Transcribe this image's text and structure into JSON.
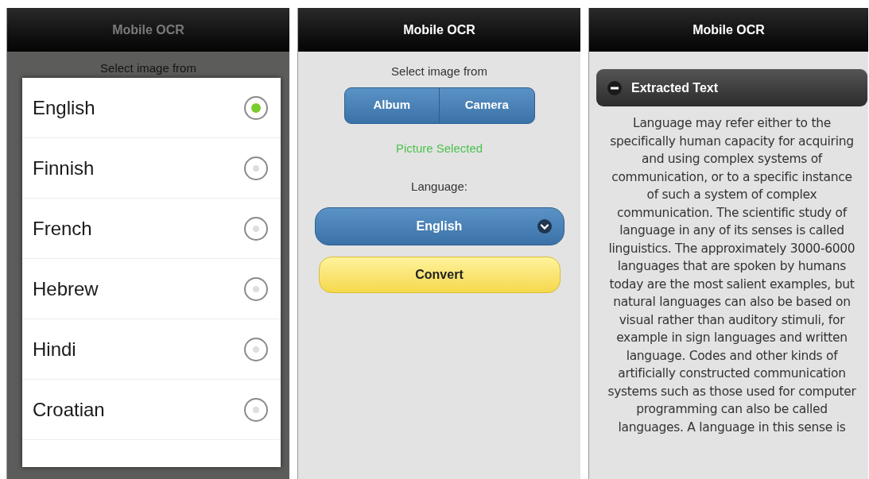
{
  "screens": [
    {
      "kind": "picker",
      "title": "Mobile OCR",
      "behind_label": "Select image from",
      "options": [
        {
          "label": "English",
          "selected": true
        },
        {
          "label": "Finnish",
          "selected": false
        },
        {
          "label": "French",
          "selected": false
        },
        {
          "label": "Hebrew",
          "selected": false
        },
        {
          "label": "Hindi",
          "selected": false
        },
        {
          "label": "Croatian",
          "selected": false
        }
      ]
    },
    {
      "kind": "form",
      "title": "Mobile OCR",
      "source_label": "Select image from",
      "source_buttons": [
        "Album",
        "Camera"
      ],
      "status": "Picture Selected",
      "language_label": "Language:",
      "language_value": "English",
      "convert_button": "Convert"
    },
    {
      "kind": "result",
      "title": "Mobile OCR",
      "section_title": "Extracted Text",
      "expanded": true,
      "text": "Language may refer either to the specifically human capacity for acquiring and using complex systems of communication, or to a specific instance of such a system of complex communication. The scientific study of language in any of its senses is called linguistics. The approximately 3000-6000 languages that are spoken by humans today are the most salient examples, but natural languages can also be based on visual rather than auditory stimuli, for example in sign languages and written language. Codes and other kinds of artificially constructed communication systems such as those used for computer programming can also be called languages. A language in this sense is"
    }
  ]
}
